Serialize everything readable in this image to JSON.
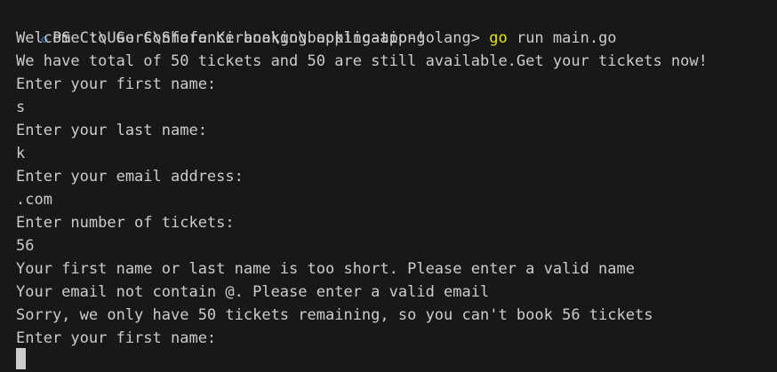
{
  "prompt": {
    "marker": "◇",
    "path": "PS C:\\Users\\Shafa Kirana\\go\\booking-app-golang> ",
    "command_keyword": "go",
    "command_args": " run main.go"
  },
  "output_lines": [
    "Welcome to Go Conference booking application!",
    "We have total of 50 tickets and 50 are still available.Get your tickets now!",
    "Enter your first name:",
    "s",
    "Enter your last name:",
    "k",
    "Enter your email address:",
    ".com",
    "Enter number of tickets:",
    "56",
    "Your first name or last name is too short. Please enter a valid name",
    "Your email not contain @. Please enter a valid email",
    "Sorry, we only have 50 tickets remaining, so you can't book 56 tickets",
    "Enter your first name:"
  ]
}
